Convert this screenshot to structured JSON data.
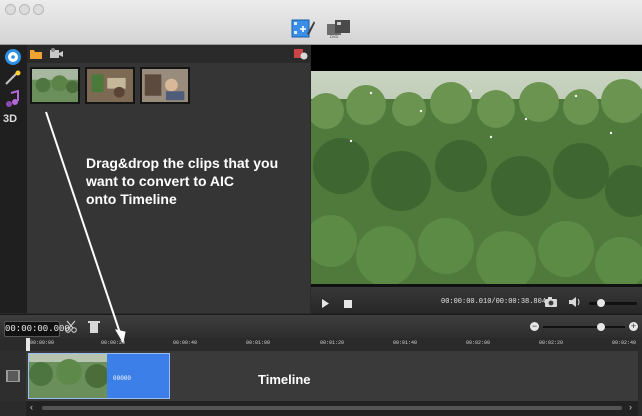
{
  "window": {
    "toolbar_tools": [
      "edit-tool-icon",
      "convert-tool-icon"
    ]
  },
  "media_panel": {
    "clips": [
      "clip-1",
      "clip-2",
      "clip-3"
    ],
    "instruction": "Drag&drop the clips that you\nwant to convert to AIC\nonto Timeline"
  },
  "preview": {
    "timecode": "00:00:00.010/00:00:38.804"
  },
  "bottom_toolbar": {
    "current_time": "00:00:00.000"
  },
  "timeline": {
    "ticks": [
      "00:00:00",
      "00:00:20",
      "00:00:40",
      "00:01:00",
      "00:01:20",
      "00:01:40",
      "00:02:00",
      "00:02:20",
      "00:02:40"
    ],
    "clip_label": "00000",
    "track_label": "Timeline"
  },
  "colors": {
    "clip": "#3d7fe8",
    "accent": "#2f8fe3"
  }
}
